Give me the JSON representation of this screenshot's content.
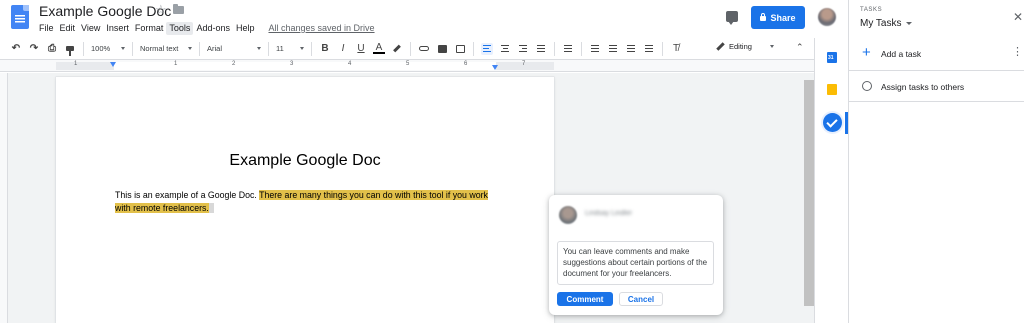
{
  "header": {
    "doc_title": "Example Google Doc",
    "star_glyph": "☆",
    "menu": [
      "File",
      "Edit",
      "View",
      "Insert",
      "Format",
      "Tools",
      "Add-ons",
      "Help"
    ],
    "active_menu": "Tools",
    "save_status": "All changes saved in Drive",
    "share_label": "Share"
  },
  "toolbar": {
    "zoom": "100%",
    "style": "Normal text",
    "font": "Arial",
    "font_size": "11",
    "mode": "Editing",
    "undo_glyph": "↶",
    "redo_glyph": "↷",
    "print_glyph": "⎙",
    "bold": "B",
    "italic": "I",
    "underline": "U",
    "text_color": "A",
    "clear_glyph": "T̸",
    "collapse_glyph": "⌃"
  },
  "ruler": {
    "marks": [
      "1",
      "1",
      "2",
      "3",
      "4",
      "5",
      "6",
      "7"
    ]
  },
  "document": {
    "heading": "Example Google Doc",
    "body_plain": "This is an example of a Google Doc. ",
    "body_highlight": "There are many things you can do with this tool if you work with remote freelancers.",
    "highlight_color": "#e2c04a"
  },
  "comment": {
    "user": "Lindsay Lindler",
    "text": "You can leave comments and make suggestions about certain portions of the document for your freelancers.",
    "submit_label": "Comment",
    "cancel_label": "Cancel"
  },
  "tasks_panel": {
    "header_label": "TASKS",
    "list_name": "My Tasks",
    "close_glyph": "✕",
    "add_task_label": "Add a task",
    "add_glyph": "+",
    "more_glyph": "⋮",
    "assign_label": "Assign tasks to others"
  },
  "colors": {
    "accent": "#1a73e8",
    "highlight": "#e2c04a"
  }
}
